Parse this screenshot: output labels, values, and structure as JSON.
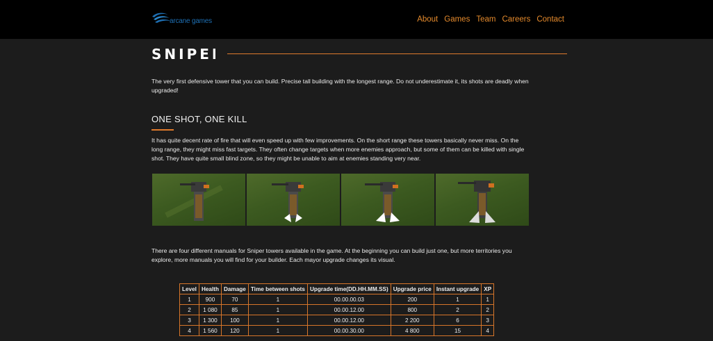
{
  "brand": {
    "name": "arcane games",
    "color": "#1e6fb3",
    "icon": "wave-logo-icon"
  },
  "nav": [
    {
      "label": "About"
    },
    {
      "label": "Games"
    },
    {
      "label": "Team"
    },
    {
      "label": "Careers"
    },
    {
      "label": "Contact"
    }
  ],
  "accent": "#e58a2c",
  "page": {
    "title": "SNIPER",
    "intro": "The very first defensive tower that you can build. Precise tall building with the longest range. Do not underestimate it, its shots are deadly when upgraded!",
    "section_heading": "ONE SHOT, ONE KILL",
    "section_text": "It has quite decent rate of fire that will even speed up with few improvements. On the short range these towers basically never miss. On the long range, they might miss fast targets. They often change targets when more enemies approach, but some of them can be killed with single shot. They have quite small blind zone, so they might be unable to aim at enemies standing very near.",
    "manuals_text": "There are four different manuals for Sniper towers available in the game. At the beginning you can build just one, but more territories you explore, more manuals you will find for your builder. Each mayor upgrade changes its visual."
  },
  "gallery": [
    {
      "icon": "sniper-tower-level-1-image"
    },
    {
      "icon": "sniper-tower-level-2-image"
    },
    {
      "icon": "sniper-tower-level-3-image"
    },
    {
      "icon": "sniper-tower-level-4-image"
    }
  ],
  "stats_table": {
    "headers": [
      "Level",
      "Health",
      "Damage",
      "Time between shots",
      "Upgrade time(DD.HH.MM.SS)",
      "Upgrade price",
      "Instant upgrade",
      "XP"
    ],
    "rows": [
      [
        "1",
        "900",
        "70",
        "1",
        "00.00.00.03",
        "200",
        "1",
        "1"
      ],
      [
        "2",
        "1 080",
        "85",
        "1",
        "00.00.12.00",
        "800",
        "2",
        "2"
      ],
      [
        "3",
        "1 300",
        "100",
        "1",
        "00.00.12.00",
        "2 200",
        "6",
        "3"
      ],
      [
        "4",
        "1 560",
        "120",
        "1",
        "00.00.30.00",
        "4 800",
        "15",
        "4"
      ]
    ]
  }
}
